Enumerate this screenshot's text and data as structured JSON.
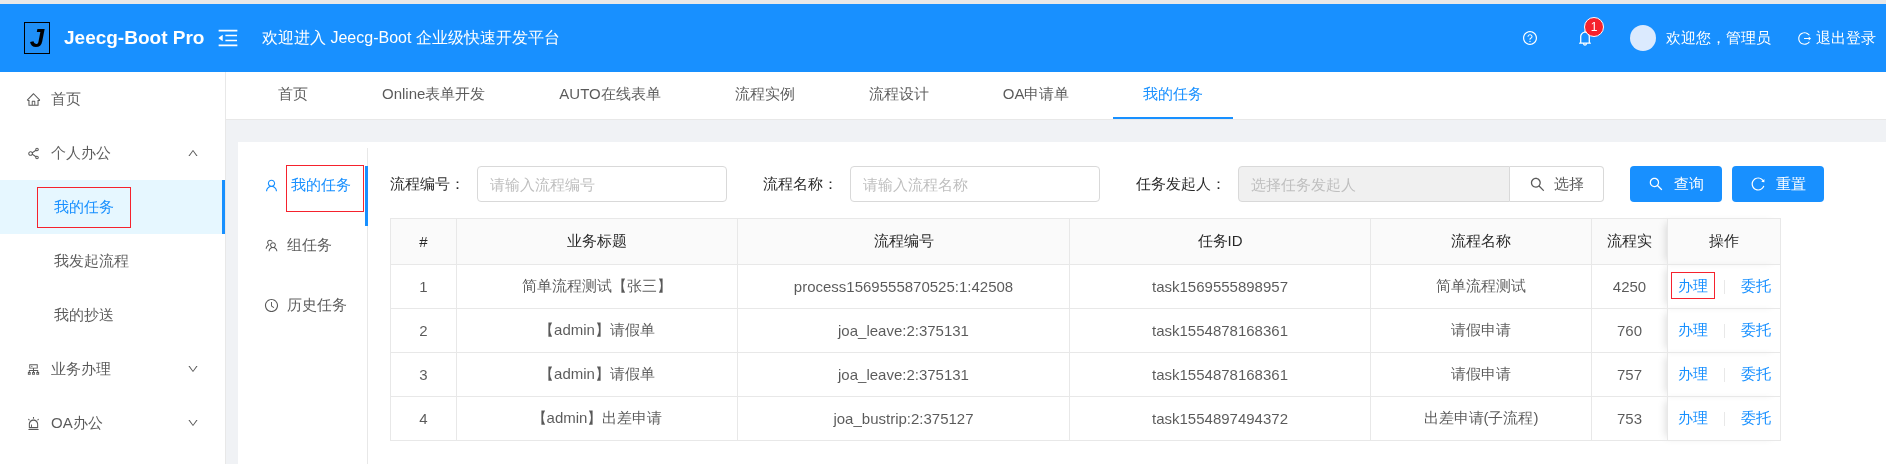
{
  "header": {
    "logo_mark": "J",
    "app_name": "Jeecg-Boot Pro",
    "welcome_text": "欢迎进入 Jeecg-Boot 企业级快速开发平台",
    "notification_count": "1",
    "user_greeting": "欢迎您，管理员",
    "logout": "退出登录"
  },
  "sidebar": {
    "items": [
      {
        "label": "首页",
        "selected": false
      },
      {
        "label": "个人办公",
        "selected": false,
        "expanded": true,
        "children": [
          {
            "label": "我的任务",
            "selected": true,
            "highlighted": true
          },
          {
            "label": "我发起流程",
            "selected": false,
            "highlighted": false
          },
          {
            "label": "我的抄送",
            "selected": false,
            "highlighted": false
          }
        ]
      },
      {
        "label": "业务办理",
        "selected": false,
        "expanded": false
      },
      {
        "label": "OA办公",
        "selected": false,
        "expanded": false
      }
    ]
  },
  "tabs": [
    {
      "label": "首页",
      "selected": false
    },
    {
      "label": "Online表单开发",
      "selected": false
    },
    {
      "label": "AUTO在线表单",
      "selected": false
    },
    {
      "label": "流程实例",
      "selected": false
    },
    {
      "label": "流程设计",
      "selected": false
    },
    {
      "label": "OA申请单",
      "selected": false
    },
    {
      "label": "我的任务",
      "selected": true
    }
  ],
  "task_nav": [
    {
      "label": "我的任务",
      "selected": true,
      "highlighted": true
    },
    {
      "label": "组任务",
      "selected": false,
      "highlighted": false
    },
    {
      "label": "历史任务",
      "selected": false,
      "highlighted": false
    }
  ],
  "filters": {
    "process_number": {
      "label": "流程编号：",
      "placeholder": "请输入流程编号"
    },
    "process_name": {
      "label": "流程名称：",
      "placeholder": "请输入流程名称"
    },
    "initiator": {
      "label": "任务发起人：",
      "placeholder": "选择任务发起人",
      "button": "选择",
      "disabled": true
    }
  },
  "buttons": [
    {
      "label": "查询",
      "kind": "search"
    },
    {
      "label": "重置",
      "kind": "reset"
    }
  ],
  "table": {
    "columns": [
      "#",
      "业务标题",
      "流程编号",
      "任务ID",
      "流程名称",
      "流程实",
      "操作"
    ],
    "rows": [
      {
        "cells": [
          "1",
          "简单流程测试【张三】",
          "process1569555870525:1:42508",
          "task1569555898957",
          "简单流程测试",
          "4250"
        ],
        "actions": [
          {
            "label": "办理",
            "highlighted": true
          },
          {
            "label": "委托",
            "highlighted": false
          }
        ]
      },
      {
        "cells": [
          "2",
          "【admin】请假单",
          "joa_leave:2:375131",
          "task1554878168361",
          "请假申请",
          "760"
        ],
        "actions": [
          {
            "label": "办理",
            "highlighted": false
          },
          {
            "label": "委托",
            "highlighted": false
          }
        ]
      },
      {
        "cells": [
          "3",
          "【admin】请假单",
          "joa_leave:2:375131",
          "task1554878168361",
          "请假申请",
          "757"
        ],
        "actions": [
          {
            "label": "办理",
            "highlighted": false
          },
          {
            "label": "委托",
            "highlighted": false
          }
        ]
      },
      {
        "cells": [
          "4",
          "【admin】出差申请",
          "joa_bustrip:2:375127",
          "task1554897494372",
          "出差申请(子流程)",
          "753"
        ],
        "actions": [
          {
            "label": "办理",
            "highlighted": false
          },
          {
            "label": "委托",
            "highlighted": false
          }
        ]
      }
    ]
  }
}
